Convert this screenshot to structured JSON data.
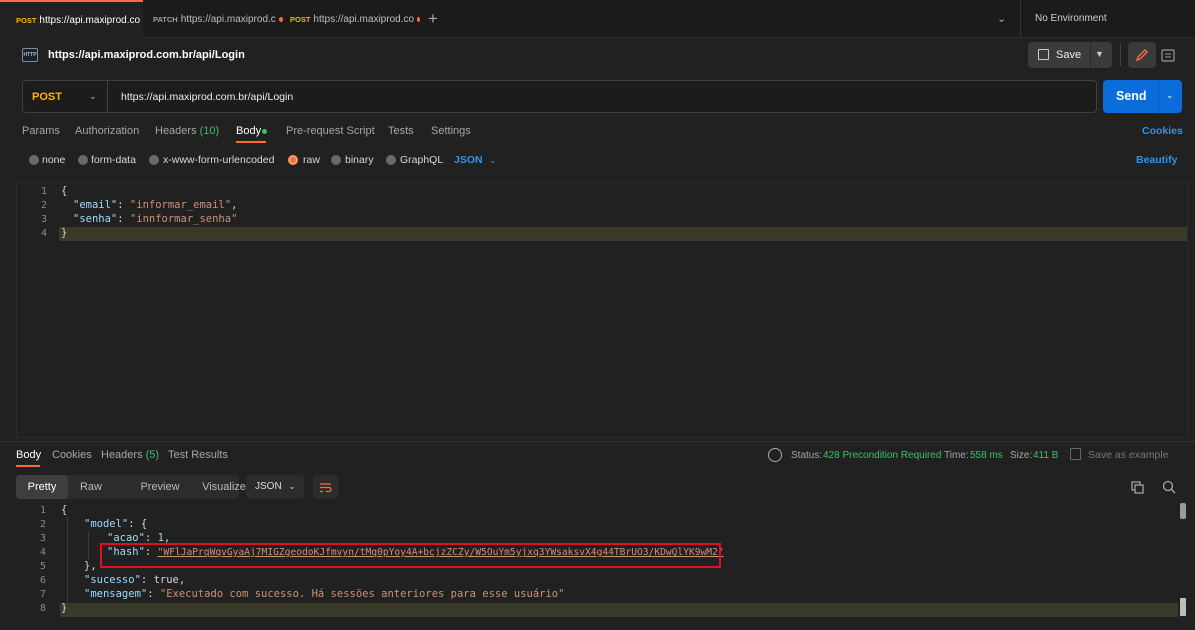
{
  "tabs": [
    {
      "method": "POST",
      "url": "https://api.maxiprod.co",
      "active": true
    },
    {
      "method": "PATCH",
      "url": "https://api.maxiprod.c",
      "active": false
    },
    {
      "method": "POST",
      "url": "https://api.maxiprod.co",
      "active": false
    }
  ],
  "environment": "No Environment",
  "request": {
    "icon_text": "HTTP",
    "title": "https://api.maxiprod.com.br/api/Login",
    "method": "POST",
    "url": "https://api.maxiprod.com.br/api/Login",
    "save_label": "Save",
    "send_label": "Send"
  },
  "request_tabs": {
    "params": "Params",
    "authorization": "Authorization",
    "headers": "Headers",
    "headers_count": "(10)",
    "body": "Body",
    "prerequest": "Pre-request Script",
    "tests": "Tests",
    "settings": "Settings",
    "cookies": "Cookies"
  },
  "body_types": {
    "none": "none",
    "form_data": "form-data",
    "urlencoded": "x-www-form-urlencoded",
    "raw": "raw",
    "binary": "binary",
    "graphql": "GraphQL",
    "format": "JSON",
    "beautify": "Beautify",
    "selected": "raw"
  },
  "request_body": {
    "line_numbers": [
      "1",
      "2",
      "3",
      "4"
    ],
    "open_brace": "{",
    "email_key": "\"email\"",
    "email_value": "\"informar_email\"",
    "senha_key": "\"senha\"",
    "senha_value": "\"innformar_senha\"",
    "close_brace": "}"
  },
  "response_tabs": {
    "body": "Body",
    "cookies": "Cookies",
    "headers": "Headers",
    "headers_count": "(5)",
    "test_results": "Test Results"
  },
  "response_meta": {
    "status_label": "Status:",
    "status_value": "428 Precondition Required",
    "time_label": "Time:",
    "time_value": "558 ms",
    "size_label": "Size:",
    "size_value": "411 B",
    "save_example": "Save as example"
  },
  "response_view": {
    "pretty": "Pretty",
    "raw": "Raw",
    "preview": "Preview",
    "visualize": "Visualize",
    "format": "JSON"
  },
  "response_body": {
    "line_numbers": [
      "1",
      "2",
      "3",
      "4",
      "5",
      "6",
      "7",
      "8"
    ],
    "open_brace": "{",
    "model_key": "\"model\"",
    "acao_key": "\"acao\"",
    "acao_value": "1",
    "hash_key": "\"hash\"",
    "hash_value": "\"WFlJaPrqWqvGyaAj7MIGZgeodoKJfmvyn/tMq0pYoy4A+bcjzZCZy/W5OuYm5yjxq3YWsaksvX4g44TBrUO3/KDwQlYK9wM2\"",
    "sucesso_key": "\"sucesso\"",
    "sucesso_value": "true",
    "mensagem_key": "\"mensagem\"",
    "mensagem_value": "\"Executado com sucesso. Há sessões anteriores para esse usuário\"",
    "close_brace": "}"
  }
}
